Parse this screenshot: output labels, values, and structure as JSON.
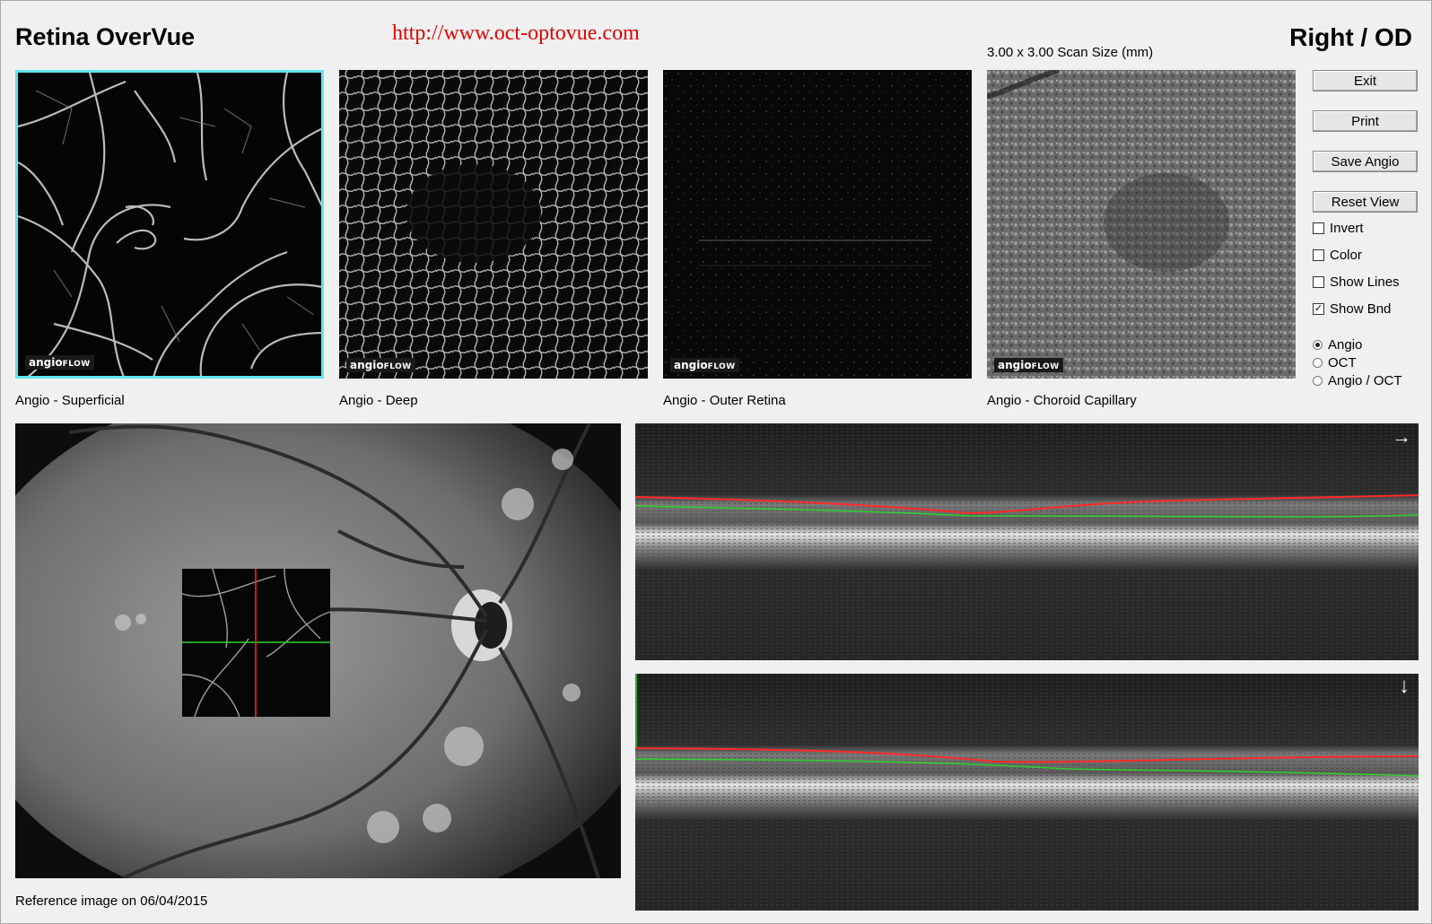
{
  "header": {
    "app_title": "Retina OverVue",
    "url": "http://www.oct-optovue.com",
    "eye": "Right / OD",
    "scan_size": "3.00 x 3.00 Scan Size (mm)"
  },
  "thumbnails": [
    {
      "caption": "Angio - Superficial",
      "watermark_a": "angio",
      "watermark_b": "FLOW",
      "selected": true
    },
    {
      "caption": "Angio - Deep",
      "watermark_a": "angio",
      "watermark_b": "FLOW",
      "selected": false
    },
    {
      "caption": "Angio - Outer Retina",
      "watermark_a": "angio",
      "watermark_b": "FLOW",
      "selected": false
    },
    {
      "caption": "Angio - Choroid Capillary",
      "watermark_a": "angio",
      "watermark_b": "FLOW",
      "selected": false
    }
  ],
  "buttons": {
    "exit": "Exit",
    "print": "Print",
    "save_angio": "Save Angio",
    "reset_view": "Reset View"
  },
  "checkboxes": {
    "invert": {
      "label": "Invert",
      "checked": false
    },
    "color": {
      "label": "Color",
      "checked": false
    },
    "show_lines": {
      "label": "Show Lines",
      "checked": false
    },
    "show_bnd": {
      "label": "Show Bnd",
      "checked": true
    }
  },
  "radios": {
    "angio": {
      "label": "Angio",
      "selected": true
    },
    "oct": {
      "label": "OCT",
      "selected": false
    },
    "angio_oct": {
      "label": "Angio / OCT",
      "selected": false
    }
  },
  "reference": {
    "caption": "Reference image on 06/04/2015"
  },
  "colors": {
    "selection_border": "#5fe6ee",
    "url_red": "#e00000",
    "boundary_red": "#ff2a2a",
    "boundary_green": "#2fd12f"
  },
  "icons": {
    "oct_top_direction": "arrow-right-icon",
    "oct_bottom_direction": "arrow-down-icon"
  }
}
